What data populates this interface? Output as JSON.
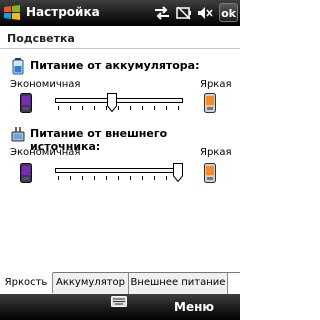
{
  "title_bar": {
    "app_title": "Настройка",
    "ok_label": "ok",
    "tray_icons": [
      "connectivity-icon",
      "battery-icon",
      "volume-icon"
    ]
  },
  "page": {
    "title": "Подсветка"
  },
  "battery_section": {
    "heading": "Питание от аккумулятора:",
    "min_label": "Экономичная",
    "max_label": "Яркая",
    "level": 0.45
  },
  "external_section": {
    "heading": "Питание от внешнего источника:",
    "min_label": "Экономичная",
    "max_label": "Яркая",
    "level": 1.0
  },
  "tabs": [
    {
      "label": "Яркость",
      "active": true
    },
    {
      "label": "Аккумулятор",
      "active": false
    },
    {
      "label": "Внешнее питание",
      "active": false
    }
  ],
  "soft_bar": {
    "menu_label": "Меню",
    "keyboard_icon": "keyboard-icon"
  }
}
